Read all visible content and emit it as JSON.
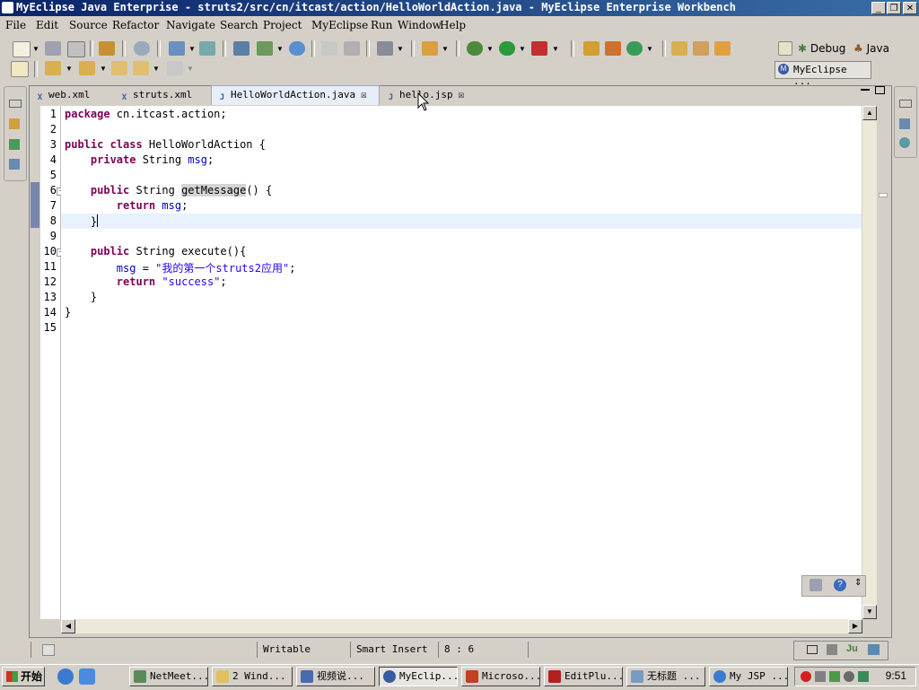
{
  "window": {
    "title": "MyEclipse Java Enterprise - struts2/src/cn/itcast/action/HelloWorldAction.java - MyEclipse Enterprise Workbench"
  },
  "menu": [
    "File",
    "Edit",
    "Source",
    "Refactor",
    "Navigate",
    "Search",
    "Project",
    "MyEclipse",
    "Run",
    "Window",
    "Help"
  ],
  "perspectives": {
    "debug": "Debug",
    "java": "Java",
    "myeclipse": "MyEclipse ..."
  },
  "tabs": [
    {
      "label": "web.xml",
      "icon": "x",
      "active": false
    },
    {
      "label": "struts.xml",
      "icon": "x",
      "active": false
    },
    {
      "label": "HelloWorldAction.java",
      "icon": "j",
      "active": true
    },
    {
      "label": "hello.jsp",
      "icon": "jsp",
      "active": false
    }
  ],
  "editor": {
    "line_numbers": [
      "1",
      "2",
      "3",
      "4",
      "5",
      "6",
      "7",
      "8",
      "9",
      "10",
      "11",
      "12",
      "13",
      "14",
      "15"
    ],
    "lines": [
      {
        "pre": "",
        "kw": "package",
        "post": " cn.itcast.action;"
      },
      {
        "pre": "",
        "kw": "",
        "post": ""
      },
      {
        "pre": "",
        "kw": "public class",
        "post": " HelloWorldAction {"
      },
      {
        "pre": "    ",
        "kw": "private",
        "post": " String ",
        "field": "msg",
        "tail": ";"
      },
      {
        "pre": "",
        "kw": "",
        "post": ""
      },
      {
        "pre": "    ",
        "kw": "public",
        "post": " String ",
        "hl": "getMessage",
        "tail": "() {"
      },
      {
        "pre": "        ",
        "kw": "return",
        "post": " ",
        "field": "msg",
        "tail": ";"
      },
      {
        "pre": "    }",
        "kw": "",
        "post": ""
      },
      {
        "pre": "",
        "kw": "",
        "post": ""
      },
      {
        "pre": "    ",
        "kw": "public",
        "post": " String execute(){"
      },
      {
        "pre": "        ",
        "kw": "",
        "post": "",
        "field": "msg",
        "tail": " = ",
        "str": "\"我的第一个struts2应用\"",
        "end": ";"
      },
      {
        "pre": "        ",
        "kw": "return",
        "post": " ",
        "str": "\"success\"",
        "end": ";"
      },
      {
        "pre": "    }",
        "kw": "",
        "post": ""
      },
      {
        "pre": "}",
        "kw": "",
        "post": ""
      },
      {
        "pre": "",
        "kw": "",
        "post": ""
      }
    ]
  },
  "status": {
    "writable": "Writable",
    "insert_mode": "Smart Insert",
    "position": "8 : 6"
  },
  "taskbar": {
    "start": "开始",
    "tasks": [
      "NetMeet...",
      "2 Wind...",
      "视频说...",
      "MyEclip...",
      "Microso...",
      "EditPlu...",
      "无标题 ...",
      "My JSP ..."
    ],
    "clock": "9:51"
  },
  "colors": {
    "keyword": "#7f0055",
    "string": "#2a00ff",
    "field": "#0000c0",
    "current_line": "#e8f2fe",
    "titlebar": "#0a246a"
  }
}
